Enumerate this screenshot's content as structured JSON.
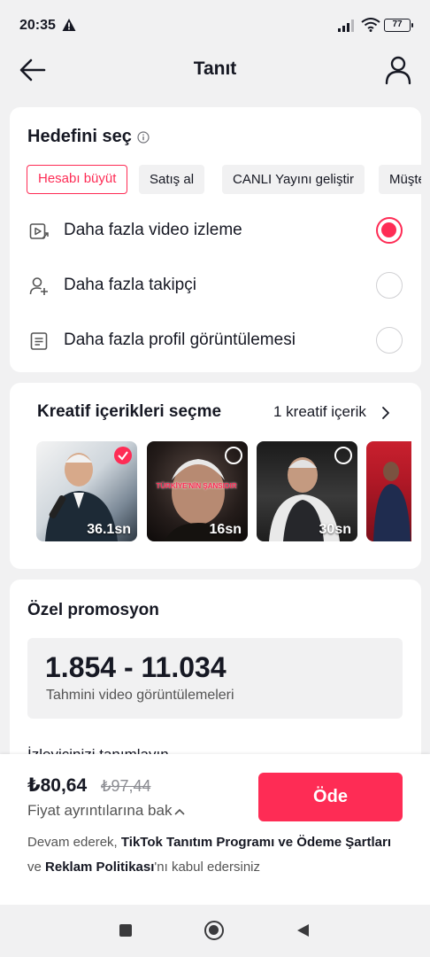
{
  "status_bar": {
    "time": "20:35",
    "battery": "77"
  },
  "header": {
    "title": "Tanıt"
  },
  "goal": {
    "title": "Hedefini seç",
    "chips": [
      {
        "label": "Hesabı büyüt",
        "selected": true
      },
      {
        "label": "Satış al",
        "selected": false
      },
      {
        "label": "CANLI Yayını geliştir",
        "selected": false
      },
      {
        "label": "Müşte",
        "selected": false
      }
    ],
    "options": [
      {
        "label": "Daha fazla video izleme",
        "icon": "video-play-icon",
        "selected": true
      },
      {
        "label": "Daha fazla takipçi",
        "icon": "add-user-icon",
        "selected": false
      },
      {
        "label": "Daha fazla profil görüntülemesi",
        "icon": "profile-document-icon",
        "selected": false
      }
    ]
  },
  "creative": {
    "title": "Kreatif içerikleri seçme",
    "count": "1 kreatif içerik",
    "thumbnails": [
      {
        "duration": "36.1sn",
        "selected": true,
        "caption": ""
      },
      {
        "duration": "16sn",
        "selected": false,
        "caption": "TÜRKİYE'NİN ŞANSIDIR"
      },
      {
        "duration": "30sn",
        "selected": false,
        "caption": ""
      },
      {
        "duration": "",
        "selected": false,
        "caption": ""
      }
    ]
  },
  "promo": {
    "title": "Özel promosyon",
    "estimate_range": "1.854 - 11.034",
    "estimate_label": "Tahmini video görüntülemeleri",
    "audience_hint": "İzleyicinizi tanımlayın"
  },
  "checkout": {
    "price": "₺80,64",
    "old_price": "₺97,44",
    "details_label": "Fiyat ayrıntılarına bak",
    "pay_label": "Öde",
    "terms_prefix": "Devam ederek, ",
    "terms_link1": "TikTok Tanıtım Programı ve Ödeme Şartları",
    "terms_mid": "ve ",
    "terms_link2": "Reklam Politikası",
    "terms_suffix": "'nı kabul edersiniz"
  },
  "colors": {
    "accent": "#fe2c55",
    "background": "#f1f1f2",
    "text": "#161823"
  }
}
